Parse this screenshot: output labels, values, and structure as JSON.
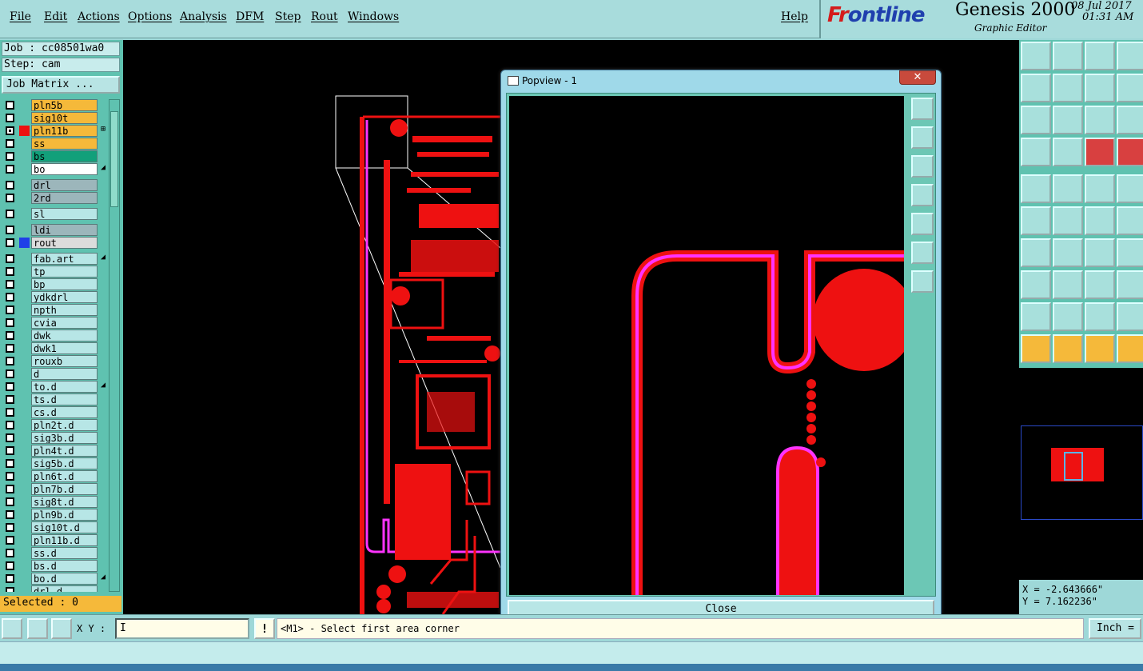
{
  "menu": {
    "file": "File",
    "edit": "Edit",
    "actions": "Actions",
    "options": "Options",
    "analysis": "Analysis",
    "dfm": "DFM",
    "step": "Step",
    "rout": "Rout",
    "windows": "Windows",
    "help": "Help"
  },
  "brand": {
    "logo_prefix": "Fr",
    "logo_rest": "ontline",
    "product": "Genesis 2000",
    "subtitle": "Graphic Editor",
    "date": "08 Jul 2017",
    "time": "01:31 AM"
  },
  "job": {
    "job_label": "Job : cc08501wa0",
    "step_label": "Step: cam",
    "matrix_button": "Job Matrix ..."
  },
  "layers": [
    {
      "name": "pln5b",
      "bg": "#f5b93a",
      "checked": false,
      "color": ""
    },
    {
      "name": "sig10t",
      "bg": "#f5b93a",
      "checked": false,
      "color": ""
    },
    {
      "name": "pln11b",
      "bg": "#f5b93a",
      "checked": true,
      "color": "#ee1111",
      "mark": "⊞"
    },
    {
      "name": "ss",
      "bg": "#f5b93a",
      "checked": false,
      "color": ""
    },
    {
      "name": "bs",
      "bg": "#12a07a",
      "checked": false,
      "color": ""
    },
    {
      "name": "bo",
      "bg": "#ffffff",
      "checked": false,
      "color": "",
      "mark": "◢"
    },
    {
      "name": "drl",
      "bg": "#9cb6bb",
      "checked": false,
      "color": ""
    },
    {
      "name": "2rd",
      "bg": "#9cb6bb",
      "checked": false,
      "color": ""
    },
    {
      "name": "sl",
      "bg": "#b7e6e6",
      "checked": false,
      "color": ""
    },
    {
      "name": "ldi",
      "bg": "#9cb6bb",
      "checked": false,
      "color": ""
    },
    {
      "name": "rout",
      "bg": "#dcdcdc",
      "checked": false,
      "color": "#1f3fe8"
    },
    {
      "name": "fab.art",
      "bg": "#b7e6e6",
      "checked": false,
      "color": "",
      "mark": "◢"
    },
    {
      "name": "tp",
      "bg": "#b7e6e6",
      "checked": false,
      "color": ""
    },
    {
      "name": "bp",
      "bg": "#b7e6e6",
      "checked": false,
      "color": ""
    },
    {
      "name": "ydkdrl",
      "bg": "#b7e6e6",
      "checked": false,
      "color": ""
    },
    {
      "name": "npth",
      "bg": "#b7e6e6",
      "checked": false,
      "color": ""
    },
    {
      "name": "cvia",
      "bg": "#b7e6e6",
      "checked": false,
      "color": ""
    },
    {
      "name": "dwk",
      "bg": "#b7e6e6",
      "checked": false,
      "color": ""
    },
    {
      "name": "dwk1",
      "bg": "#b7e6e6",
      "checked": false,
      "color": ""
    },
    {
      "name": "rouxb",
      "bg": "#b7e6e6",
      "checked": false,
      "color": ""
    },
    {
      "name": "d",
      "bg": "#b7e6e6",
      "checked": false,
      "color": ""
    },
    {
      "name": "to.d",
      "bg": "#b7e6e6",
      "checked": false,
      "color": "",
      "mark": "◢"
    },
    {
      "name": "ts.d",
      "bg": "#b7e6e6",
      "checked": false,
      "color": ""
    },
    {
      "name": "cs.d",
      "bg": "#b7e6e6",
      "checked": false,
      "color": ""
    },
    {
      "name": "pln2t.d",
      "bg": "#b7e6e6",
      "checked": false,
      "color": ""
    },
    {
      "name": "sig3b.d",
      "bg": "#b7e6e6",
      "checked": false,
      "color": ""
    },
    {
      "name": "pln4t.d",
      "bg": "#b7e6e6",
      "checked": false,
      "color": ""
    },
    {
      "name": "sig5b.d",
      "bg": "#b7e6e6",
      "checked": false,
      "color": ""
    },
    {
      "name": "pln6t.d",
      "bg": "#b7e6e6",
      "checked": false,
      "color": ""
    },
    {
      "name": "pln7b.d",
      "bg": "#b7e6e6",
      "checked": false,
      "color": ""
    },
    {
      "name": "sig8t.d",
      "bg": "#b7e6e6",
      "checked": false,
      "color": ""
    },
    {
      "name": "pln9b.d",
      "bg": "#b7e6e6",
      "checked": false,
      "color": ""
    },
    {
      "name": "sig10t.d",
      "bg": "#b7e6e6",
      "checked": false,
      "color": ""
    },
    {
      "name": "pln11b.d",
      "bg": "#b7e6e6",
      "checked": false,
      "color": ""
    },
    {
      "name": "ss.d",
      "bg": "#b7e6e6",
      "checked": false,
      "color": ""
    },
    {
      "name": "bs.d",
      "bg": "#b7e6e6",
      "checked": false,
      "color": ""
    },
    {
      "name": "bo.d",
      "bg": "#b7e6e6",
      "checked": false,
      "color": "",
      "mark": "◢"
    },
    {
      "name": "drl.d",
      "bg": "#b7e6e6",
      "checked": false,
      "color": ""
    }
  ],
  "selected_label": "Selected : 0",
  "popview": {
    "title": "Popview - 1",
    "close_x": "✕",
    "close_button": "Close"
  },
  "coords": {
    "x": "X = -2.643666\"",
    "y": "Y = 7.162236\""
  },
  "status": {
    "xy_label": "X Y :",
    "xy_value": "I",
    "excl": "!",
    "prompt": "<M1> - Select first area corner",
    "units": "Inch ="
  },
  "colors": {
    "copper": "#ee1111",
    "outline": "#ff33ff",
    "panel": "#5fc2b0",
    "highlight": "#f5b93a"
  }
}
